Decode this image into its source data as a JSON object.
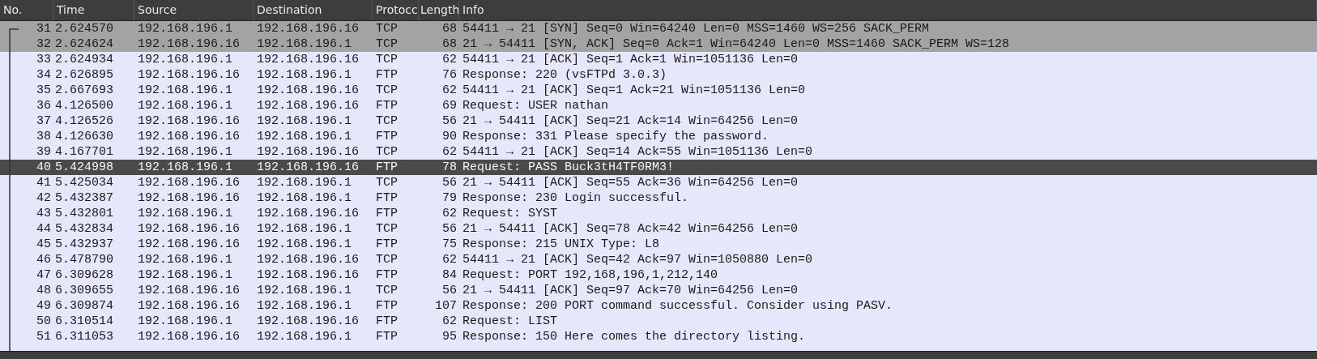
{
  "columns": [
    "No.",
    "Time",
    "Source",
    "Destination",
    "Protocc",
    "Length",
    "Info"
  ],
  "rows": [
    {
      "no": "31",
      "time": "2.624570",
      "source": "192.168.196.1",
      "destination": "192.168.196.16",
      "protocol": "TCP",
      "length": "68",
      "info": "54411 → 21 [SYN] Seq=0 Win=64240 Len=0 MSS=1460 WS=256 SACK_PERM",
      "selected": false,
      "highlighted": true
    },
    {
      "no": "32",
      "time": "2.624624",
      "source": "192.168.196.16",
      "destination": "192.168.196.1",
      "protocol": "TCP",
      "length": "68",
      "info": "21 → 54411 [SYN, ACK] Seq=0 Ack=1 Win=64240 Len=0 MSS=1460 SACK_PERM WS=128",
      "selected": false,
      "highlighted": true
    },
    {
      "no": "33",
      "time": "2.624934",
      "source": "192.168.196.1",
      "destination": "192.168.196.16",
      "protocol": "TCP",
      "length": "62",
      "info": "54411 → 21 [ACK] Seq=1 Ack=1 Win=1051136 Len=0",
      "selected": false,
      "highlighted": false
    },
    {
      "no": "34",
      "time": "2.626895",
      "source": "192.168.196.16",
      "destination": "192.168.196.1",
      "protocol": "FTP",
      "length": "76",
      "info": "Response: 220 (vsFTPd 3.0.3)",
      "selected": false,
      "highlighted": false
    },
    {
      "no": "35",
      "time": "2.667693",
      "source": "192.168.196.1",
      "destination": "192.168.196.16",
      "protocol": "TCP",
      "length": "62",
      "info": "54411 → 21 [ACK] Seq=1 Ack=21 Win=1051136 Len=0",
      "selected": false,
      "highlighted": false
    },
    {
      "no": "36",
      "time": "4.126500",
      "source": "192.168.196.1",
      "destination": "192.168.196.16",
      "protocol": "FTP",
      "length": "69",
      "info": "Request: USER nathan",
      "selected": false,
      "highlighted": false
    },
    {
      "no": "37",
      "time": "4.126526",
      "source": "192.168.196.16",
      "destination": "192.168.196.1",
      "protocol": "TCP",
      "length": "56",
      "info": "21 → 54411 [ACK] Seq=21 Ack=14 Win=64256 Len=0",
      "selected": false,
      "highlighted": false
    },
    {
      "no": "38",
      "time": "4.126630",
      "source": "192.168.196.16",
      "destination": "192.168.196.1",
      "protocol": "FTP",
      "length": "90",
      "info": "Response: 331 Please specify the password.",
      "selected": false,
      "highlighted": false
    },
    {
      "no": "39",
      "time": "4.167701",
      "source": "192.168.196.1",
      "destination": "192.168.196.16",
      "protocol": "TCP",
      "length": "62",
      "info": "54411 → 21 [ACK] Seq=14 Ack=55 Win=1051136 Len=0",
      "selected": false,
      "highlighted": false
    },
    {
      "no": "40",
      "time": "5.424998",
      "source": "192.168.196.1",
      "destination": "192.168.196.16",
      "protocol": "FTP",
      "length": "78",
      "info": "Request: PASS Buck3tH4TF0RM3!",
      "selected": true,
      "highlighted": false
    },
    {
      "no": "41",
      "time": "5.425034",
      "source": "192.168.196.16",
      "destination": "192.168.196.1",
      "protocol": "TCP",
      "length": "56",
      "info": "21 → 54411 [ACK] Seq=55 Ack=36 Win=64256 Len=0",
      "selected": false,
      "highlighted": false
    },
    {
      "no": "42",
      "time": "5.432387",
      "source": "192.168.196.16",
      "destination": "192.168.196.1",
      "protocol": "FTP",
      "length": "79",
      "info": "Response: 230 Login successful.",
      "selected": false,
      "highlighted": false
    },
    {
      "no": "43",
      "time": "5.432801",
      "source": "192.168.196.1",
      "destination": "192.168.196.16",
      "protocol": "FTP",
      "length": "62",
      "info": "Request: SYST",
      "selected": false,
      "highlighted": false
    },
    {
      "no": "44",
      "time": "5.432834",
      "source": "192.168.196.16",
      "destination": "192.168.196.1",
      "protocol": "TCP",
      "length": "56",
      "info": "21 → 54411 [ACK] Seq=78 Ack=42 Win=64256 Len=0",
      "selected": false,
      "highlighted": false
    },
    {
      "no": "45",
      "time": "5.432937",
      "source": "192.168.196.16",
      "destination": "192.168.196.1",
      "protocol": "FTP",
      "length": "75",
      "info": "Response: 215 UNIX Type: L8",
      "selected": false,
      "highlighted": false
    },
    {
      "no": "46",
      "time": "5.478790",
      "source": "192.168.196.1",
      "destination": "192.168.196.16",
      "protocol": "TCP",
      "length": "62",
      "info": "54411 → 21 [ACK] Seq=42 Ack=97 Win=1050880 Len=0",
      "selected": false,
      "highlighted": false
    },
    {
      "no": "47",
      "time": "6.309628",
      "source": "192.168.196.1",
      "destination": "192.168.196.16",
      "protocol": "FTP",
      "length": "84",
      "info": "Request: PORT 192,168,196,1,212,140",
      "selected": false,
      "highlighted": false
    },
    {
      "no": "48",
      "time": "6.309655",
      "source": "192.168.196.16",
      "destination": "192.168.196.1",
      "protocol": "TCP",
      "length": "56",
      "info": "21 → 54411 [ACK] Seq=97 Ack=70 Win=64256 Len=0",
      "selected": false,
      "highlighted": false
    },
    {
      "no": "49",
      "time": "6.309874",
      "source": "192.168.196.16",
      "destination": "192.168.196.1",
      "protocol": "FTP",
      "length": "107",
      "info": "Response: 200 PORT command successful. Consider using PASV.",
      "selected": false,
      "highlighted": false
    },
    {
      "no": "50",
      "time": "6.310514",
      "source": "192.168.196.1",
      "destination": "192.168.196.16",
      "protocol": "FTP",
      "length": "62",
      "info": "Request: LIST",
      "selected": false,
      "highlighted": false
    },
    {
      "no": "51",
      "time": "6.311053",
      "source": "192.168.196.16",
      "destination": "192.168.196.1",
      "protocol": "FTP",
      "length": "95",
      "info": "Response: 150 Here comes the directory listing.",
      "selected": false,
      "highlighted": false
    }
  ]
}
